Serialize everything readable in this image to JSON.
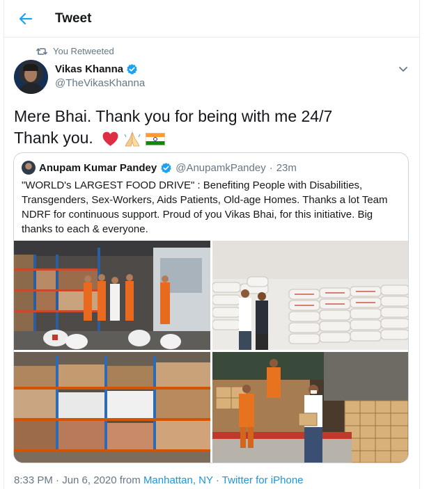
{
  "header": {
    "title": "Tweet"
  },
  "retweet": {
    "label": "You Retweeted"
  },
  "author": {
    "name": "Vikas Khanna",
    "handle": "@TheVikasKhanna"
  },
  "tweet": {
    "line1": "Mere Bhai. Thank you for being with me 24/7",
    "line2": "Thank you."
  },
  "quote": {
    "name": "Anupam Kumar Pandey",
    "handle": "@AnupamkPandey",
    "separator": "·",
    "time": "23m",
    "text": "\"WORLD's LARGEST FOOD DRIVE\" : Benefiting People with Disabilities, Transgenders, Sex-Workers, Aids Patients, Old-age Homes. Thanks a lot Team NDRF for continuous support. Proud of you Vikas Bhai, for this initiative. Big thanks to each & everyone."
  },
  "meta": {
    "time": "8:33 PM · Jun 6, 2020 from ",
    "location": "Manhattan, NY",
    "separator": " · ",
    "source": "Twitter for iPhone"
  },
  "colors": {
    "accent": "#1da1f2",
    "muted": "#657786",
    "border": "#ccd6dd",
    "link": "#1b95e0"
  },
  "icons": [
    "back-arrow-icon",
    "retweet-icon",
    "verified-badge-icon",
    "chevron-down-icon",
    "heart-emoji-icon",
    "folded-hands-emoji-icon",
    "india-flag-emoji-icon"
  ]
}
